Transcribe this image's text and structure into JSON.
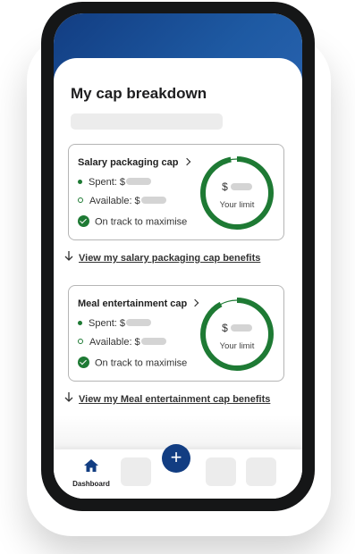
{
  "page": {
    "title": "My cap breakdown"
  },
  "cards": [
    {
      "title": "Salary packaging cap",
      "spent_label": "Spent: $",
      "available_label": "Available: $",
      "status": "On track to maximise",
      "gauge_currency": "$",
      "gauge_label": "Your limit",
      "progress_fraction": 0.97,
      "link": "View my salary packaging cap benefits"
    },
    {
      "title": "Meal entertainment cap",
      "spent_label": "Spent: $",
      "available_label": "Available: $",
      "status": "On track to maximise",
      "gauge_currency": "$",
      "gauge_label": "Your limit",
      "progress_fraction": 0.92,
      "link": "View my Meal entertainment cap benefits"
    }
  ],
  "nav": {
    "dashboard_label": "Dashboard",
    "add_symbol": "+"
  },
  "colors": {
    "brand_blue": "#123d82",
    "progress_green": "#1e7a34"
  },
  "icons": {
    "home": "home-icon",
    "add": "plus-icon",
    "chevron": "chevron-right-icon",
    "link_arrow": "arrow-down-icon",
    "status": "check-circle-icon"
  }
}
